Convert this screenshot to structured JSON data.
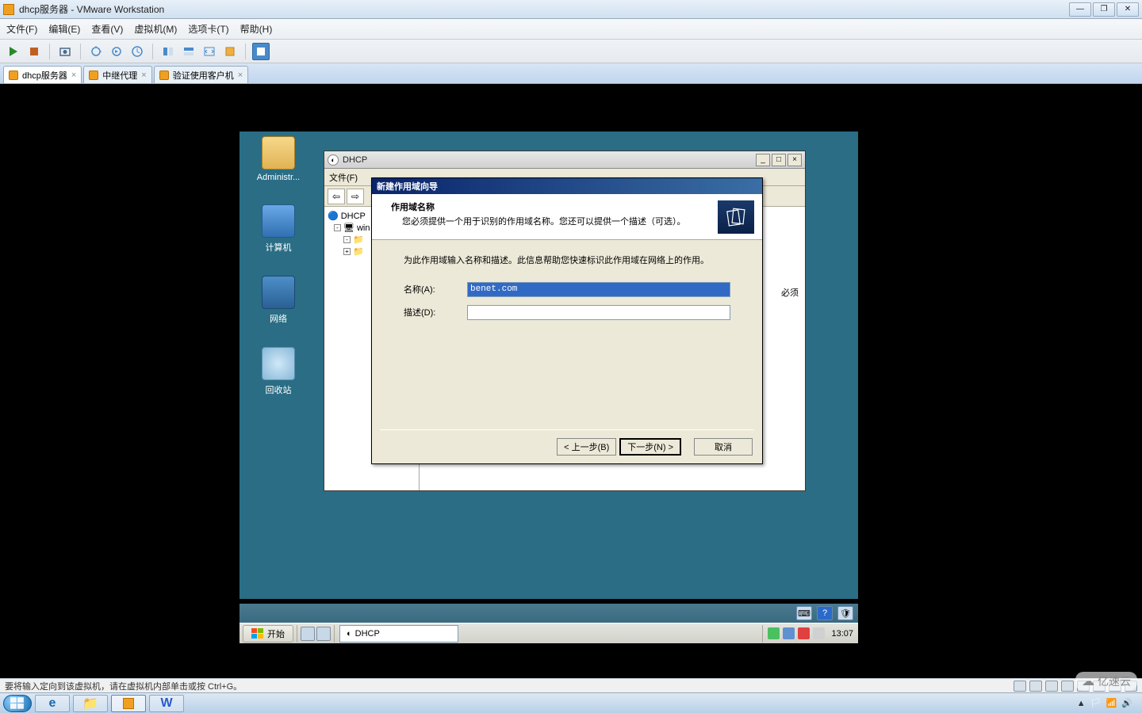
{
  "vmware": {
    "title": "dhcp服务器 - VMware Workstation",
    "menu": {
      "file": "文件(F)",
      "edit": "编辑(E)",
      "view": "查看(V)",
      "vm": "虚拟机(M)",
      "tabs": "选项卡(T)",
      "help": "帮助(H)"
    },
    "tabs": [
      {
        "label": "dhcp服务器",
        "active": true
      },
      {
        "label": "中继代理",
        "active": false
      },
      {
        "label": "验证使用客户机",
        "active": false
      }
    ],
    "status": "要将输入定向到该虚拟机，请在虚拟机内部单击或按 Ctrl+G。"
  },
  "guest": {
    "icons": {
      "admin": "Administr...",
      "computer": "计算机",
      "network": "网络",
      "recycle": "回收站"
    },
    "start": "开始",
    "task_app": "DHCP",
    "clock": "13:07"
  },
  "mmc": {
    "title": "DHCP",
    "menu_file": "文件(F)",
    "tree_root": "DHCP",
    "tree_node": "win",
    "content_hint": "必须"
  },
  "wizard": {
    "title": "新建作用域向导",
    "header_title": "作用域名称",
    "header_desc": "您必须提供一个用于识别的作用域名称。您还可以提供一个描述（可选）。",
    "instruction": "为此作用域输入名称和描述。此信息帮助您快速标识此作用域在网络上的作用。",
    "name_label": "名称(A):",
    "name_value": "benet.com",
    "desc_label": "描述(D):",
    "desc_value": "",
    "btn_back": "< 上一步(B)",
    "btn_next": "下一步(N) >",
    "btn_cancel": "取消"
  },
  "watermark": "亿速云"
}
